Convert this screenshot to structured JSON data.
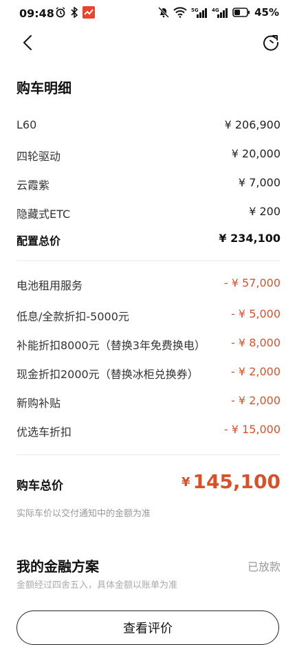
{
  "status_bar": {
    "time": "09:48",
    "battery": "45%",
    "net5g": "5G",
    "net4g": "4G"
  },
  "page": {
    "title": "购车明细"
  },
  "config_items": [
    {
      "label": "L60",
      "value": "¥ 206,900"
    },
    {
      "label": "四轮驱动",
      "value": "¥ 20,000"
    },
    {
      "label": "云霞紫",
      "value": "¥ 7,000"
    },
    {
      "label": "隐藏式ETC",
      "value": "¥ 200"
    }
  ],
  "config_total": {
    "label": "配置总价",
    "value": "¥ 234,100"
  },
  "discounts": [
    {
      "label": "电池租用服务",
      "value": "- ¥ 57,000"
    },
    {
      "label": "低息/全款折扣-5000元",
      "value": "- ¥ 5,000"
    },
    {
      "label": "补能折扣8000元（替换3年免费换电）",
      "value": "- ¥ 8,000"
    },
    {
      "label": "现金折扣2000元（替换冰柜兑换券）",
      "value": "- ¥ 2,000"
    },
    {
      "label": "新购补贴",
      "value": "- ¥ 2,000"
    },
    {
      "label": "优选车折扣",
      "value": "- ¥ 15,000"
    }
  ],
  "total": {
    "label": "购车总价",
    "currency": "¥",
    "amount": "145,100",
    "note": "实际车价以交付通知中的金额为准"
  },
  "finance": {
    "title": "我的金融方案",
    "status": "已放款",
    "note": "金额经过四舍五入，具体金额以账单为准"
  },
  "action": {
    "label": "查看评价"
  },
  "colors": {
    "accent": "#d4532b",
    "muted": "#999999"
  }
}
